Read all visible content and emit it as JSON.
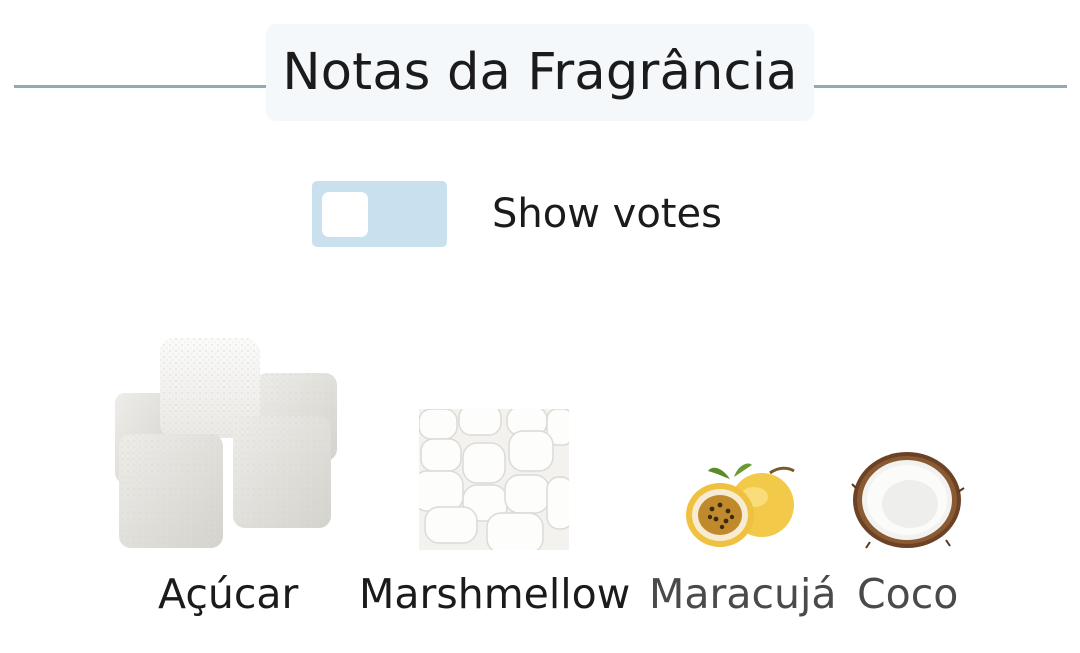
{
  "section": {
    "title": "Notas da Fragrância",
    "line_color": "#8fa9b5"
  },
  "votes_toggle": {
    "label": "Show votes",
    "state": "off",
    "track_color": "#c9e0ef"
  },
  "notes": [
    {
      "name": "Açúcar",
      "image": "sugar-cubes"
    },
    {
      "name": "Marshmellow",
      "image": "marshmallows"
    },
    {
      "name": "Maracujá",
      "image": "passion-fruit"
    },
    {
      "name": "Coco",
      "image": "coconut"
    }
  ]
}
